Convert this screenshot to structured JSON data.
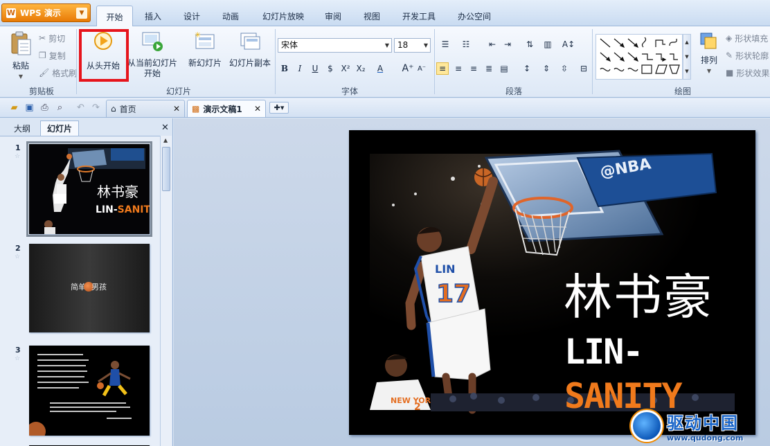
{
  "app": {
    "button_label": "WPS 演示"
  },
  "tabs": [
    "开始",
    "插入",
    "设计",
    "动画",
    "幻灯片放映",
    "审阅",
    "视图",
    "开发工具",
    "办公空间"
  ],
  "ribbon": {
    "clipboard": {
      "paste": "粘贴",
      "cut": "剪切",
      "copy": "复制",
      "format_painter": "格式刷",
      "group": "剪贴板"
    },
    "slides": {
      "from_start": "从头开始",
      "from_current_1": "从当前幻灯片",
      "from_current_2": "开始",
      "new_slide": "新幻灯片",
      "slide_copy": "幻灯片副本",
      "group": "幻灯片"
    },
    "font": {
      "name": "宋体",
      "size": "18",
      "group": "字体"
    },
    "paragraph": {
      "group": "段落"
    },
    "drawing": {
      "arrange": "排列",
      "shape_fill": "形状填充",
      "shape_outline": "形状轮廓",
      "shape_effect": "形状效果",
      "group": "绘图"
    }
  },
  "doc_tabs": [
    {
      "label": "首页"
    },
    {
      "label": "演示文稿1"
    }
  ],
  "panel": {
    "tab_outline": "大纲",
    "tab_slides": "幻灯片"
  },
  "slides": [
    {
      "num": "1",
      "title": "林书豪",
      "subtitle_a": "LIN-",
      "subtitle_b": "SANITY"
    },
    {
      "num": "2",
      "title_a": "简单",
      "title_b": "男孩"
    },
    {
      "num": "3"
    }
  ],
  "main_slide": {
    "title": "林书豪",
    "subtitle_a": "LIN-",
    "subtitle_b": "SANITY"
  },
  "watermark": {
    "name": "驱动中国",
    "url": "www.qudong.com"
  },
  "colors": {
    "accent_orange": "#f07a1c",
    "highlight_red": "#e6141c",
    "ribbon_blue": "#dde8f6"
  }
}
